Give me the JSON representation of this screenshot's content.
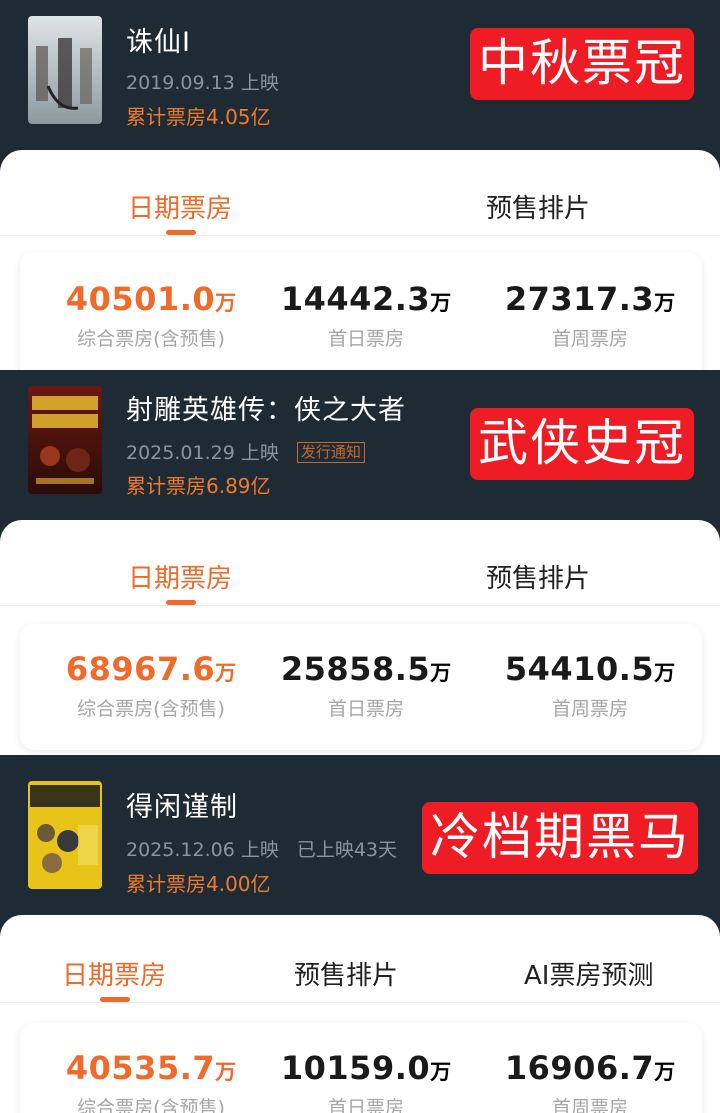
{
  "movies": [
    {
      "title": "诛仙Ⅰ",
      "release": "2019.09.13 上映",
      "cumulative": "累计票房4.05亿",
      "tag": "中秋票冠",
      "tabs": [
        "日期票房",
        "预售排片"
      ],
      "stats": [
        {
          "value": "40501.0",
          "unit": "万",
          "label": "综合票房(含预售)"
        },
        {
          "value": "14442.3",
          "unit": "万",
          "label": "首日票房"
        },
        {
          "value": "27317.3",
          "unit": "万",
          "label": "首周票房"
        }
      ]
    },
    {
      "title": "射雕英雄传：侠之大者",
      "release": "2025.01.29 上映",
      "badge": "发行通知",
      "cumulative": "累计票房6.89亿",
      "tag": "武侠史冠",
      "tabs": [
        "日期票房",
        "预售排片"
      ],
      "stats": [
        {
          "value": "68967.6",
          "unit": "万",
          "label": "综合票房(含预售)"
        },
        {
          "value": "25858.5",
          "unit": "万",
          "label": "首日票房"
        },
        {
          "value": "54410.5",
          "unit": "万",
          "label": "首周票房"
        }
      ]
    },
    {
      "title": "得闲谨制",
      "release": "2025.12.06 上映",
      "days": "已上映43天",
      "cumulative": "累计票房4.00亿",
      "tag": "冷档期黑马",
      "tabs": [
        "日期票房",
        "预售排片",
        "AI票房预测"
      ],
      "stats": [
        {
          "value": "40535.7",
          "unit": "万",
          "label": "综合票房(含预售)"
        },
        {
          "value": "10159.0",
          "unit": "万",
          "label": "首日票房"
        },
        {
          "value": "16906.7",
          "unit": "万",
          "label": "首周票房"
        }
      ]
    }
  ]
}
